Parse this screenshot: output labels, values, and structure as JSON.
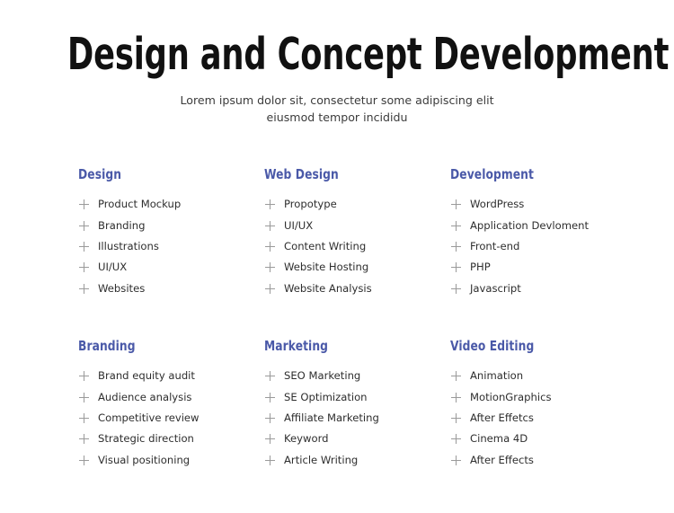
{
  "header": {
    "title": "Design and Concept Development",
    "subtitle_line1": "Lorem ipsum dolor sit, consectetur some adipiscing elit",
    "subtitle_line2": "eiusmod tempor incididu"
  },
  "colors": {
    "background": "#ffffff",
    "title": "#111111",
    "subtitle": "#3c3c3c",
    "heading_accent": "#4a59a8",
    "item_text": "#2e2e2e",
    "plus_icon": "#9a9a9a"
  },
  "icons": {
    "list_marker": "plus-icon"
  },
  "columns": [
    {
      "heading": "Design",
      "items": [
        "Product Mockup",
        "Branding",
        "Illustrations",
        "UI/UX",
        "Websites"
      ]
    },
    {
      "heading": "Web Design",
      "items": [
        "Propotype",
        "UI/UX",
        "Content Writing",
        "Website Hosting",
        "Website Analysis"
      ]
    },
    {
      "heading": "Development",
      "items": [
        "WordPress",
        "Application Devloment",
        "Front-end",
        "PHP",
        "Javascript"
      ]
    },
    {
      "heading": "Branding",
      "items": [
        "Brand equity audit",
        "Audience analysis",
        "Competitive review",
        "Strategic direction",
        "Visual positioning"
      ]
    },
    {
      "heading": "Marketing",
      "items": [
        "SEO Marketing",
        "SE Optimization",
        "Affiliate Marketing",
        "Keyword",
        "Article Writing"
      ]
    },
    {
      "heading": "Video Editing",
      "items": [
        "Animation",
        "MotionGraphics",
        "After Effetcs",
        "Cinema 4D",
        "After Effects"
      ]
    }
  ]
}
